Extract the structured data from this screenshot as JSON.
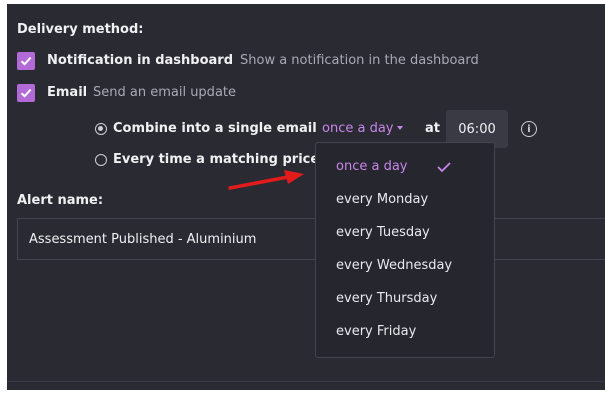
{
  "delivery": {
    "title": "Delivery method:",
    "options": [
      {
        "label": "Notification in dashboard",
        "description": "Show a notification in the dashboard",
        "checked": true
      },
      {
        "label": "Email",
        "description": "Send an email update",
        "checked": true
      }
    ]
  },
  "email_mode": {
    "combine_label": "Combine into a single email",
    "frequency_value": "once a day",
    "at_label": "at",
    "time_value": "06:00",
    "every_time_label": "Every time a matching price"
  },
  "frequency_dropdown": {
    "items": [
      "once a day",
      "every Monday",
      "every Tuesday",
      "every Wednesday",
      "every Thursday",
      "every Friday"
    ],
    "selected_index": 0
  },
  "alert_name": {
    "label": "Alert name:",
    "value": "Assessment Published - Aluminium"
  },
  "colors": {
    "panel_bg": "#2a2a33",
    "accent_purple": "#b26bd6",
    "annotation_red": "#e31b1b"
  },
  "icons": [
    "checkmark-icon",
    "info-icon",
    "caret-down-icon",
    "red-arrow-annotation"
  ]
}
